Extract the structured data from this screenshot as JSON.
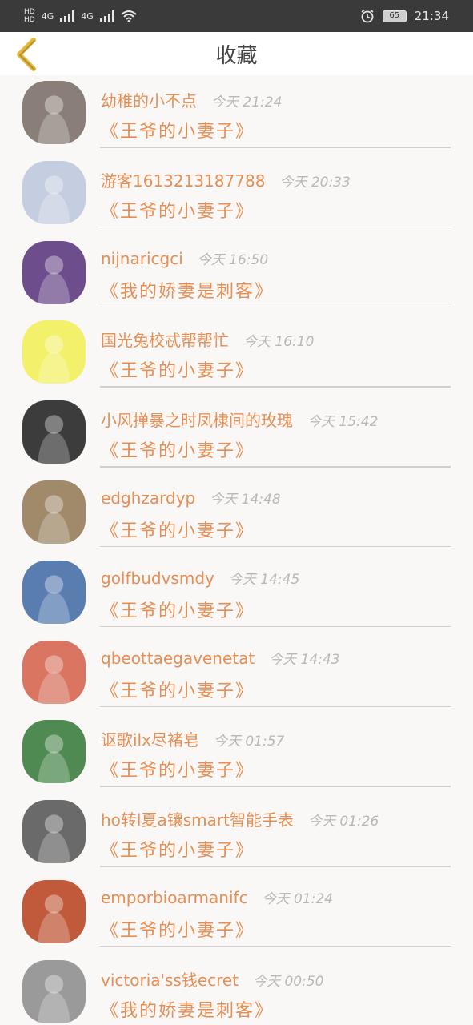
{
  "status_bar": {
    "sim1": "HD",
    "sim2": "HD",
    "net1": "4G",
    "net2": "4G",
    "battery": "65",
    "time": "21:34"
  },
  "header": {
    "title": "收藏",
    "back_icon": "chevron-left-icon"
  },
  "favorites": [
    {
      "user": "幼稚的小不点",
      "time": "今天 21:24",
      "book": "《王爷的小妻子》",
      "avatar_color": "#8a7f78"
    },
    {
      "user": "游客1613213187788",
      "time": "今天 20:33",
      "book": "《王爷的小妻子》",
      "avatar_color": "#c5cde0"
    },
    {
      "user": "nijnaricgci",
      "time": "今天 16:50",
      "book": "《我的娇妻是刺客》",
      "avatar_color": "#6e4d8c"
    },
    {
      "user": "国光兔校忒帮帮忙",
      "time": "今天 16:10",
      "book": "《王爷的小妻子》",
      "avatar_color": "#f3f06a"
    },
    {
      "user": "小风掸暴之时凤棣间的玫瑰",
      "time": "今天 15:42",
      "book": "《王爷的小妻子》",
      "avatar_color": "#3c3c3c"
    },
    {
      "user": "edghzardyp",
      "time": "今天 14:48",
      "book": "《王爷的小妻子》",
      "avatar_color": "#a08a6a"
    },
    {
      "user": "golfbudvsmdy",
      "time": "今天 14:45",
      "book": "《王爷的小妻子》",
      "avatar_color": "#5a7db0"
    },
    {
      "user": "qbeottaegavenetat",
      "time": "今天 14:43",
      "book": "《王爷的小妻子》",
      "avatar_color": "#d97560"
    },
    {
      "user": "讴歌ilx尽褚皂",
      "time": "今天 01:57",
      "book": "《王爷的小妻子》",
      "avatar_color": "#4f8a52"
    },
    {
      "user": "ho转l夏a镶smart智能手表",
      "time": "今天 01:26",
      "book": "《王爷的小妻子》",
      "avatar_color": "#6a6a6a"
    },
    {
      "user": "emporbioarmanifc",
      "time": "今天 01:24",
      "book": "《王爷的小妻子》",
      "avatar_color": "#c05a3a"
    },
    {
      "user": "victoria'ss钱ecret",
      "time": "今天 00:50",
      "book": "《我的娇妻是刺客》",
      "avatar_color": "#9a9a9a"
    }
  ]
}
